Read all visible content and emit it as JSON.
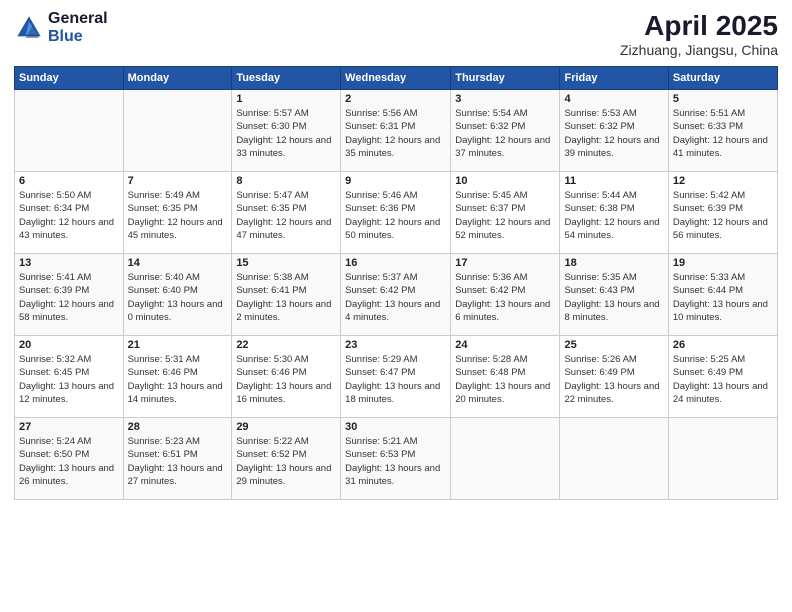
{
  "header": {
    "logo_general": "General",
    "logo_blue": "Blue",
    "title": "April 2025",
    "location": "Zizhuang, Jiangsu, China"
  },
  "weekdays": [
    "Sunday",
    "Monday",
    "Tuesday",
    "Wednesday",
    "Thursday",
    "Friday",
    "Saturday"
  ],
  "weeks": [
    [
      {
        "day": null
      },
      {
        "day": null
      },
      {
        "day": "1",
        "sunrise": "5:57 AM",
        "sunset": "6:30 PM",
        "daylight": "12 hours and 33 minutes."
      },
      {
        "day": "2",
        "sunrise": "5:56 AM",
        "sunset": "6:31 PM",
        "daylight": "12 hours and 35 minutes."
      },
      {
        "day": "3",
        "sunrise": "5:54 AM",
        "sunset": "6:32 PM",
        "daylight": "12 hours and 37 minutes."
      },
      {
        "day": "4",
        "sunrise": "5:53 AM",
        "sunset": "6:32 PM",
        "daylight": "12 hours and 39 minutes."
      },
      {
        "day": "5",
        "sunrise": "5:51 AM",
        "sunset": "6:33 PM",
        "daylight": "12 hours and 41 minutes."
      }
    ],
    [
      {
        "day": "6",
        "sunrise": "5:50 AM",
        "sunset": "6:34 PM",
        "daylight": "12 hours and 43 minutes."
      },
      {
        "day": "7",
        "sunrise": "5:49 AM",
        "sunset": "6:35 PM",
        "daylight": "12 hours and 45 minutes."
      },
      {
        "day": "8",
        "sunrise": "5:47 AM",
        "sunset": "6:35 PM",
        "daylight": "12 hours and 47 minutes."
      },
      {
        "day": "9",
        "sunrise": "5:46 AM",
        "sunset": "6:36 PM",
        "daylight": "12 hours and 50 minutes."
      },
      {
        "day": "10",
        "sunrise": "5:45 AM",
        "sunset": "6:37 PM",
        "daylight": "12 hours and 52 minutes."
      },
      {
        "day": "11",
        "sunrise": "5:44 AM",
        "sunset": "6:38 PM",
        "daylight": "12 hours and 54 minutes."
      },
      {
        "day": "12",
        "sunrise": "5:42 AM",
        "sunset": "6:39 PM",
        "daylight": "12 hours and 56 minutes."
      }
    ],
    [
      {
        "day": "13",
        "sunrise": "5:41 AM",
        "sunset": "6:39 PM",
        "daylight": "12 hours and 58 minutes."
      },
      {
        "day": "14",
        "sunrise": "5:40 AM",
        "sunset": "6:40 PM",
        "daylight": "13 hours and 0 minutes."
      },
      {
        "day": "15",
        "sunrise": "5:38 AM",
        "sunset": "6:41 PM",
        "daylight": "13 hours and 2 minutes."
      },
      {
        "day": "16",
        "sunrise": "5:37 AM",
        "sunset": "6:42 PM",
        "daylight": "13 hours and 4 minutes."
      },
      {
        "day": "17",
        "sunrise": "5:36 AM",
        "sunset": "6:42 PM",
        "daylight": "13 hours and 6 minutes."
      },
      {
        "day": "18",
        "sunrise": "5:35 AM",
        "sunset": "6:43 PM",
        "daylight": "13 hours and 8 minutes."
      },
      {
        "day": "19",
        "sunrise": "5:33 AM",
        "sunset": "6:44 PM",
        "daylight": "13 hours and 10 minutes."
      }
    ],
    [
      {
        "day": "20",
        "sunrise": "5:32 AM",
        "sunset": "6:45 PM",
        "daylight": "13 hours and 12 minutes."
      },
      {
        "day": "21",
        "sunrise": "5:31 AM",
        "sunset": "6:46 PM",
        "daylight": "13 hours and 14 minutes."
      },
      {
        "day": "22",
        "sunrise": "5:30 AM",
        "sunset": "6:46 PM",
        "daylight": "13 hours and 16 minutes."
      },
      {
        "day": "23",
        "sunrise": "5:29 AM",
        "sunset": "6:47 PM",
        "daylight": "13 hours and 18 minutes."
      },
      {
        "day": "24",
        "sunrise": "5:28 AM",
        "sunset": "6:48 PM",
        "daylight": "13 hours and 20 minutes."
      },
      {
        "day": "25",
        "sunrise": "5:26 AM",
        "sunset": "6:49 PM",
        "daylight": "13 hours and 22 minutes."
      },
      {
        "day": "26",
        "sunrise": "5:25 AM",
        "sunset": "6:49 PM",
        "daylight": "13 hours and 24 minutes."
      }
    ],
    [
      {
        "day": "27",
        "sunrise": "5:24 AM",
        "sunset": "6:50 PM",
        "daylight": "13 hours and 26 minutes."
      },
      {
        "day": "28",
        "sunrise": "5:23 AM",
        "sunset": "6:51 PM",
        "daylight": "13 hours and 27 minutes."
      },
      {
        "day": "29",
        "sunrise": "5:22 AM",
        "sunset": "6:52 PM",
        "daylight": "13 hours and 29 minutes."
      },
      {
        "day": "30",
        "sunrise": "5:21 AM",
        "sunset": "6:53 PM",
        "daylight": "13 hours and 31 minutes."
      },
      {
        "day": null
      },
      {
        "day": null
      },
      {
        "day": null
      }
    ]
  ]
}
